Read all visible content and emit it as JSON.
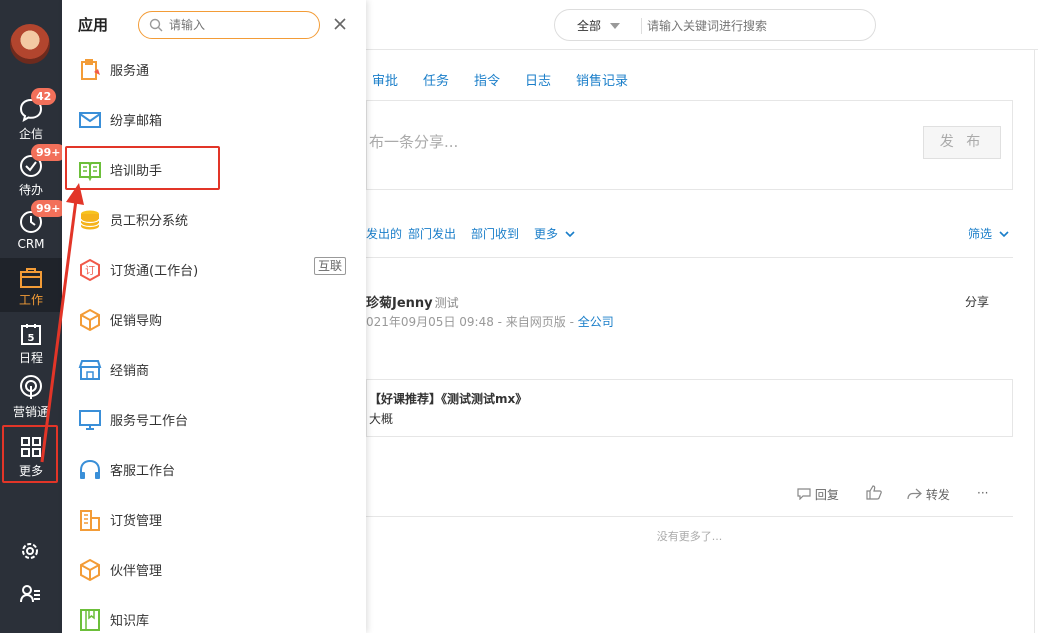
{
  "sidebar": {
    "items": [
      {
        "label": "企信",
        "badge": "42",
        "icon": "chat-bubble-icon"
      },
      {
        "label": "待办",
        "badge": "99+",
        "icon": "check-circle-icon"
      },
      {
        "label": "CRM",
        "badge": "99+",
        "icon": "clock-icon"
      },
      {
        "label": "工作",
        "badge": "",
        "icon": "briefcase-icon",
        "active": true
      },
      {
        "label": "日程",
        "badge": "",
        "icon": "calendar-icon"
      },
      {
        "label": "营销通",
        "badge": "",
        "icon": "broadcast-icon"
      },
      {
        "label": "更多",
        "badge": "",
        "icon": "grid-icon"
      }
    ],
    "calendar_day": "5",
    "bottom_icons": [
      "settings-icon",
      "user-list-icon"
    ],
    "accent": "#f39c37",
    "bg": "#2b3039"
  },
  "panel": {
    "title": "应用",
    "search_placeholder": "请输入",
    "apps": [
      {
        "label": "服务通",
        "icon": "service-clipboard-icon",
        "tag": ""
      },
      {
        "label": "纷享邮箱",
        "icon": "mail-icon",
        "tag": ""
      },
      {
        "label": "培训助手",
        "icon": "open-book-icon",
        "tag": ""
      },
      {
        "label": "员工积分系统",
        "icon": "coin-stack-icon",
        "tag": ""
      },
      {
        "label": "订货通(工作台)",
        "icon": "order-hexagon-icon",
        "tag": "互联"
      },
      {
        "label": "促销导购",
        "icon": "cube-icon",
        "tag": ""
      },
      {
        "label": "经销商",
        "icon": "storefront-icon",
        "tag": ""
      },
      {
        "label": "服务号工作台",
        "icon": "monitor-icon",
        "tag": ""
      },
      {
        "label": "客服工作台",
        "icon": "headset-icon",
        "tag": ""
      },
      {
        "label": "订货管理",
        "icon": "building-icon",
        "tag": ""
      },
      {
        "label": "伙伴管理",
        "icon": "box-icon",
        "tag": ""
      },
      {
        "label": "知识库",
        "icon": "book-bookmark-icon",
        "tag": ""
      }
    ]
  },
  "topbar": {
    "scope": "全部",
    "search_placeholder": "请输入关键词进行搜索"
  },
  "publish_tabs": [
    "审批",
    "任务",
    "指令",
    "日志",
    "销售记录"
  ],
  "composer": {
    "placeholder": "布一条分享...",
    "publish_label": "发 布"
  },
  "filter_tabs": [
    "发出的",
    "部门发出",
    "部门收到",
    "更多"
  ],
  "filter_label": "筛选",
  "post": {
    "author": "珍菊Jenny",
    "author_tag": "测试",
    "time_source": "021年09月05日 09:48 - 来自网页版 - ",
    "scope": "全公司",
    "share_label": "分享",
    "course_title": "【好课推荐】《测试测试mx》",
    "course_desc": "大概",
    "reply_label": "回复",
    "forward_label": "转发",
    "more_label": "···"
  },
  "no_more": "没有更多了..."
}
